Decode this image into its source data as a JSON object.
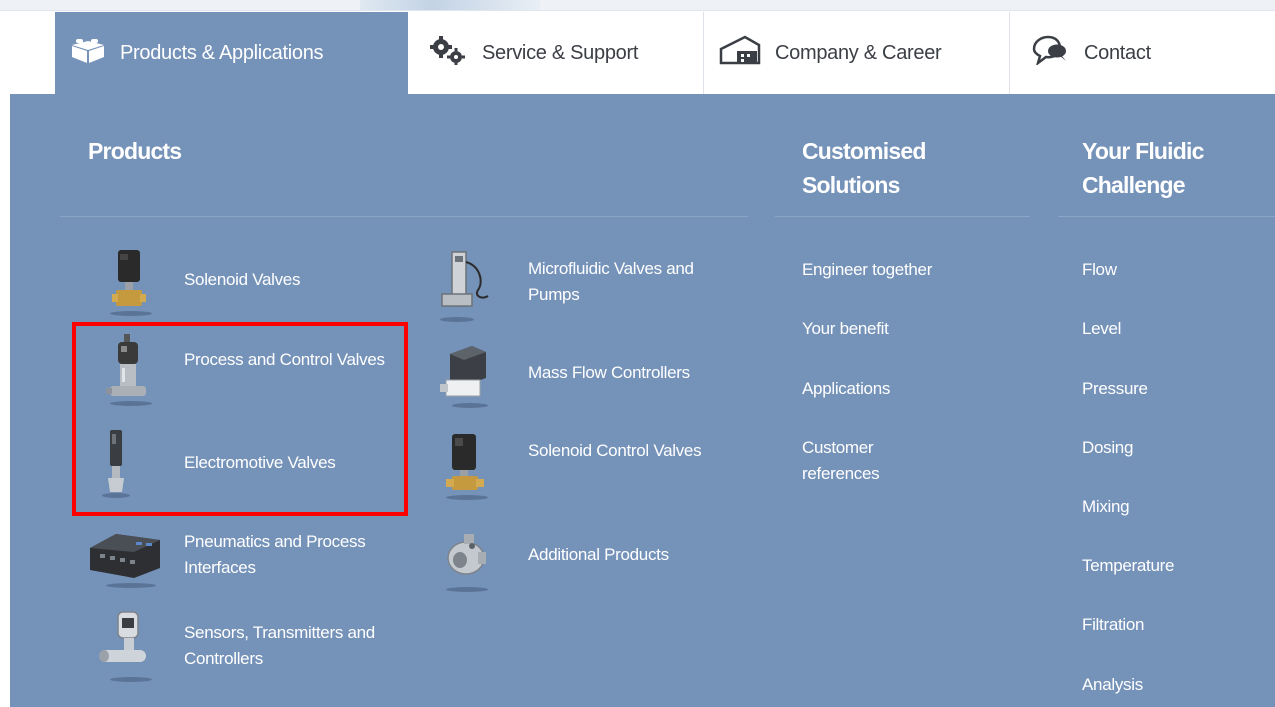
{
  "nav": {
    "tabs": [
      {
        "label": "Products & Applications",
        "icon": "products-icon",
        "active": true
      },
      {
        "label": "Service & Support",
        "icon": "gears-icon",
        "active": false
      },
      {
        "label": "Company & Career",
        "icon": "building-icon",
        "active": false
      },
      {
        "label": "Contact",
        "icon": "chat-bubbles-icon",
        "active": false
      }
    ]
  },
  "menu": {
    "products": {
      "heading": "Products",
      "col1": [
        {
          "label": "Solenoid Valves",
          "icon": "solenoid-valve-icon"
        },
        {
          "label": "Process and Control Valves",
          "icon": "process-valve-icon"
        },
        {
          "label": "Electromotive Valves",
          "icon": "electromotive-valve-icon"
        },
        {
          "label": "Pneumatics and Process Interfaces",
          "icon": "pneumatics-icon"
        },
        {
          "label": "Sensors, Transmitters and Controllers",
          "icon": "sensor-icon"
        }
      ],
      "col2": [
        {
          "label": "Microfluidic Valves and Pumps",
          "icon": "microfluidic-valve-icon"
        },
        {
          "label": "Mass Flow Controllers",
          "icon": "mass-flow-controller-icon"
        },
        {
          "label": "Solenoid Control Valves",
          "icon": "solenoid-control-valve-icon"
        },
        {
          "label": "Additional Products",
          "icon": "additional-products-icon"
        }
      ]
    },
    "customised": {
      "heading": "Customised Solutions",
      "links": [
        "Engineer together",
        "Your benefit",
        "Applications",
        "Customer references"
      ]
    },
    "fluidic": {
      "heading": "Your Fluidic Challenge",
      "links": [
        "Flow",
        "Level",
        "Pressure",
        "Dosing",
        "Mixing",
        "Temperature",
        "Filtration",
        "Analysis"
      ]
    }
  },
  "colors": {
    "panel": "#7592b9",
    "highlight": "#ff0000"
  }
}
